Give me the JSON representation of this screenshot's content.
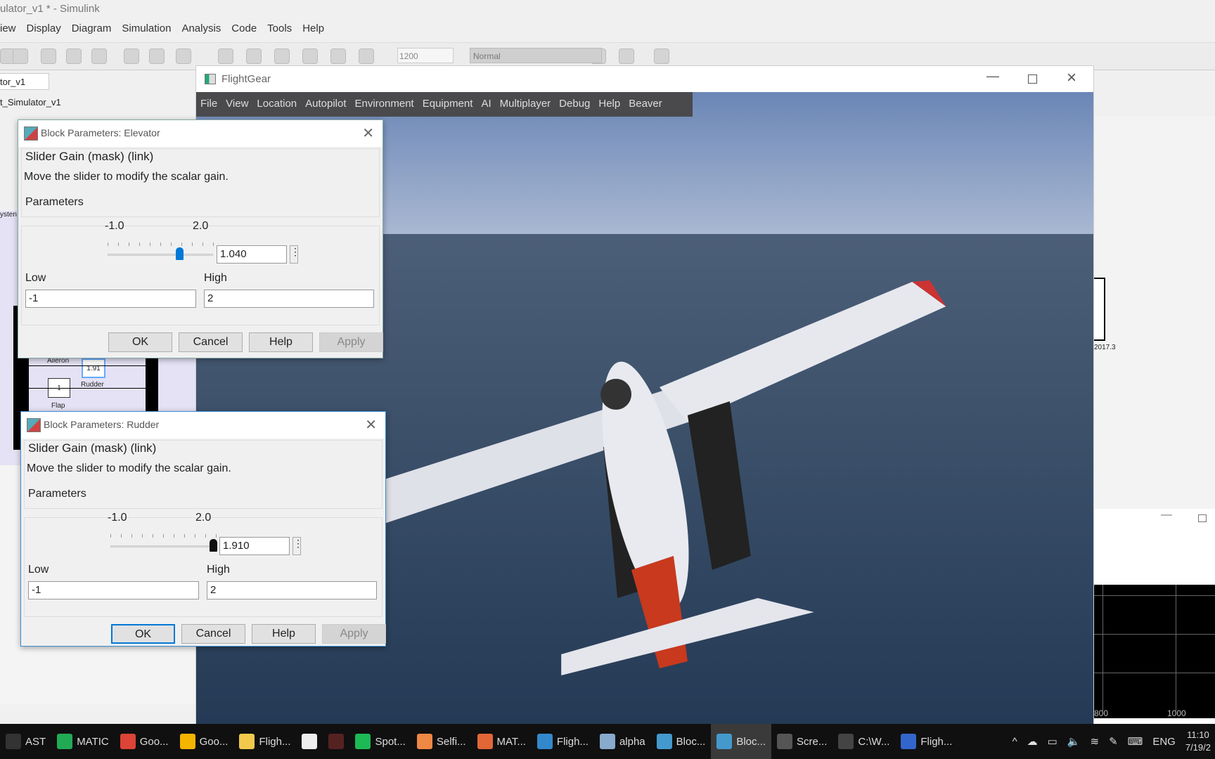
{
  "simulink": {
    "title": "ulator_v1 * - Simulink",
    "menu": [
      "iew",
      "Display",
      "Diagram",
      "Simulation",
      "Analysis",
      "Code",
      "Tools",
      "Help"
    ],
    "stop_time": "1200",
    "sim_mode": "Normal",
    "tab": "tor_v1",
    "breadcrumb": "t_Simulator_v1",
    "canvas": {
      "subsystem_label": "ysten",
      "blocks": [
        {
          "label": "Aileron",
          "value": "1.91",
          "name": "Rudder"
        },
        {
          "label": "Flap",
          "value": "1"
        }
      ],
      "right_value": "2017.3"
    },
    "scope": {
      "ticks": [
        "800",
        "1000"
      ]
    }
  },
  "flightgear": {
    "title": "FlightGear",
    "menu": [
      "File",
      "View",
      "Location",
      "Autopilot",
      "Environment",
      "Equipment",
      "AI",
      "Multiplayer",
      "Debug",
      "Help",
      "Beaver"
    ]
  },
  "dialogs": [
    {
      "title": "Block Parameters: Elevator",
      "type": "Slider Gain (mask) (link)",
      "description": "Move the slider to modify the scalar gain.",
      "group": "Parameters",
      "min_label": "-1.0",
      "max_label": "2.0",
      "value": "1.040",
      "slider_fraction": 0.68,
      "low_label": "Low",
      "low": "-1",
      "high_label": "High",
      "high": "2",
      "buttons": {
        "ok": "OK",
        "cancel": "Cancel",
        "help": "Help",
        "apply": "Apply"
      },
      "thumb_color": "#0078d7"
    },
    {
      "title": "Block Parameters: Rudder",
      "type": "Slider Gain (mask) (link)",
      "description": "Move the slider to modify the scalar gain.",
      "group": "Parameters",
      "min_label": "-1.0",
      "max_label": "2.0",
      "value": "1.910",
      "slider_fraction": 0.97,
      "low_label": "Low",
      "low": "-1",
      "high_label": "High",
      "high": "2",
      "buttons": {
        "ok": "OK",
        "cancel": "Cancel",
        "help": "Help",
        "apply": "Apply"
      },
      "thumb_color": "#111111"
    }
  ],
  "taskbar": {
    "items": [
      {
        "label": "AST",
        "icon": "app-icon",
        "color": "#333"
      },
      {
        "label": "MATIC",
        "icon": "app-icon",
        "color": "#2a5"
      },
      {
        "label": "Goo...",
        "icon": "chrome-icon",
        "color": "#db4437"
      },
      {
        "label": "Goo...",
        "icon": "chrome-icon",
        "color": "#f4b400"
      },
      {
        "label": "Fligh...",
        "icon": "folder-icon",
        "color": "#f2c94c"
      },
      {
        "label": "",
        "icon": "mail-icon",
        "color": "#eee"
      },
      {
        "label": "",
        "icon": "app-icon",
        "color": "#522"
      },
      {
        "label": "Spot...",
        "icon": "spotify-icon",
        "color": "#1db954"
      },
      {
        "label": "Selfi...",
        "icon": "app-icon",
        "color": "#e84"
      },
      {
        "label": "MAT...",
        "icon": "matlab-icon",
        "color": "#e16737"
      },
      {
        "label": "Fligh...",
        "icon": "simulink-icon",
        "color": "#38c"
      },
      {
        "label": "alpha",
        "icon": "matlab-icon",
        "color": "#8ac"
      },
      {
        "label": "Bloc...",
        "icon": "simulink-icon",
        "color": "#49c"
      },
      {
        "label": "Bloc...",
        "icon": "simulink-icon",
        "color": "#49c",
        "active": true
      },
      {
        "label": "Scre...",
        "icon": "snip-icon",
        "color": "#555"
      },
      {
        "label": "C:\\W...",
        "icon": "cmd-icon",
        "color": "#444"
      },
      {
        "label": "Fligh...",
        "icon": "flightgear-icon",
        "color": "#36c"
      }
    ],
    "language": "ENG",
    "time": "11:10",
    "date": "7/19/2"
  }
}
